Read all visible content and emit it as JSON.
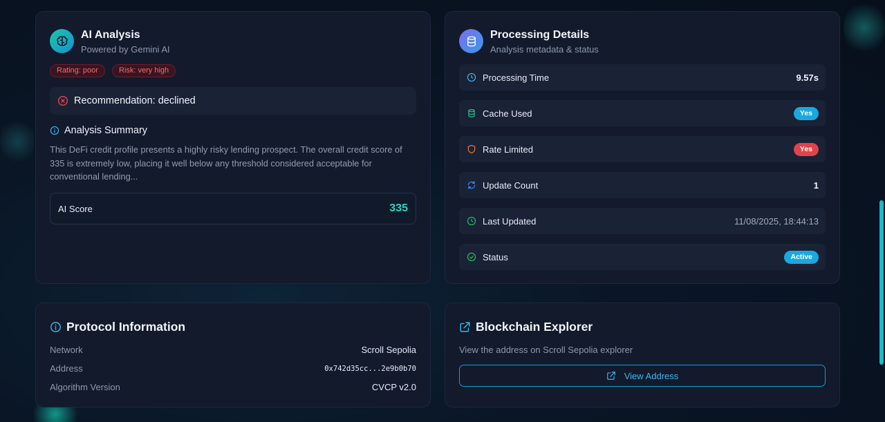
{
  "ai_analysis": {
    "title": "AI Analysis",
    "subtitle": "Powered by Gemini AI",
    "rating_badge": "Rating: poor",
    "risk_badge": "Risk: very high",
    "recommendation": "Recommendation: declined",
    "summary_title": "Analysis Summary",
    "summary_text": "This DeFi credit profile presents a highly risky lending prospect. The overall credit score of 335 is extremely low, placing it well below any threshold considered acceptable for conventional lending...",
    "score_label": "AI Score",
    "score_value": "335"
  },
  "processing": {
    "title": "Processing Details",
    "subtitle": "Analysis metadata & status",
    "rows": [
      {
        "label": "Processing Time",
        "value": "9.57s",
        "icon": "clock-icon"
      },
      {
        "label": "Cache Used",
        "value": "Yes",
        "icon": "database-icon"
      },
      {
        "label": "Rate Limited",
        "value": "Yes",
        "icon": "shield-icon"
      },
      {
        "label": "Update Count",
        "value": "1",
        "icon": "refresh-icon"
      },
      {
        "label": "Last Updated",
        "value": "11/08/2025, 18:44:13",
        "icon": "clock-icon"
      },
      {
        "label": "Status",
        "value": "Active",
        "icon": "check-circle-icon"
      }
    ]
  },
  "protocol": {
    "title": "Protocol Information",
    "rows": [
      {
        "label": "Network",
        "value": "Scroll Sepolia"
      },
      {
        "label": "Address",
        "value": "0x742d35cc...2e9b0b70"
      },
      {
        "label": "Algorithm Version",
        "value": "CVCP v2.0"
      }
    ]
  },
  "explorer": {
    "title": "Blockchain Explorer",
    "description": "View the address on Scroll Sepolia explorer",
    "button_label": "View Address"
  },
  "colors": {
    "accent": "#1fb8e8",
    "danger": "#ef4444",
    "score": "#2dd4bf",
    "success": "#22c55e"
  }
}
